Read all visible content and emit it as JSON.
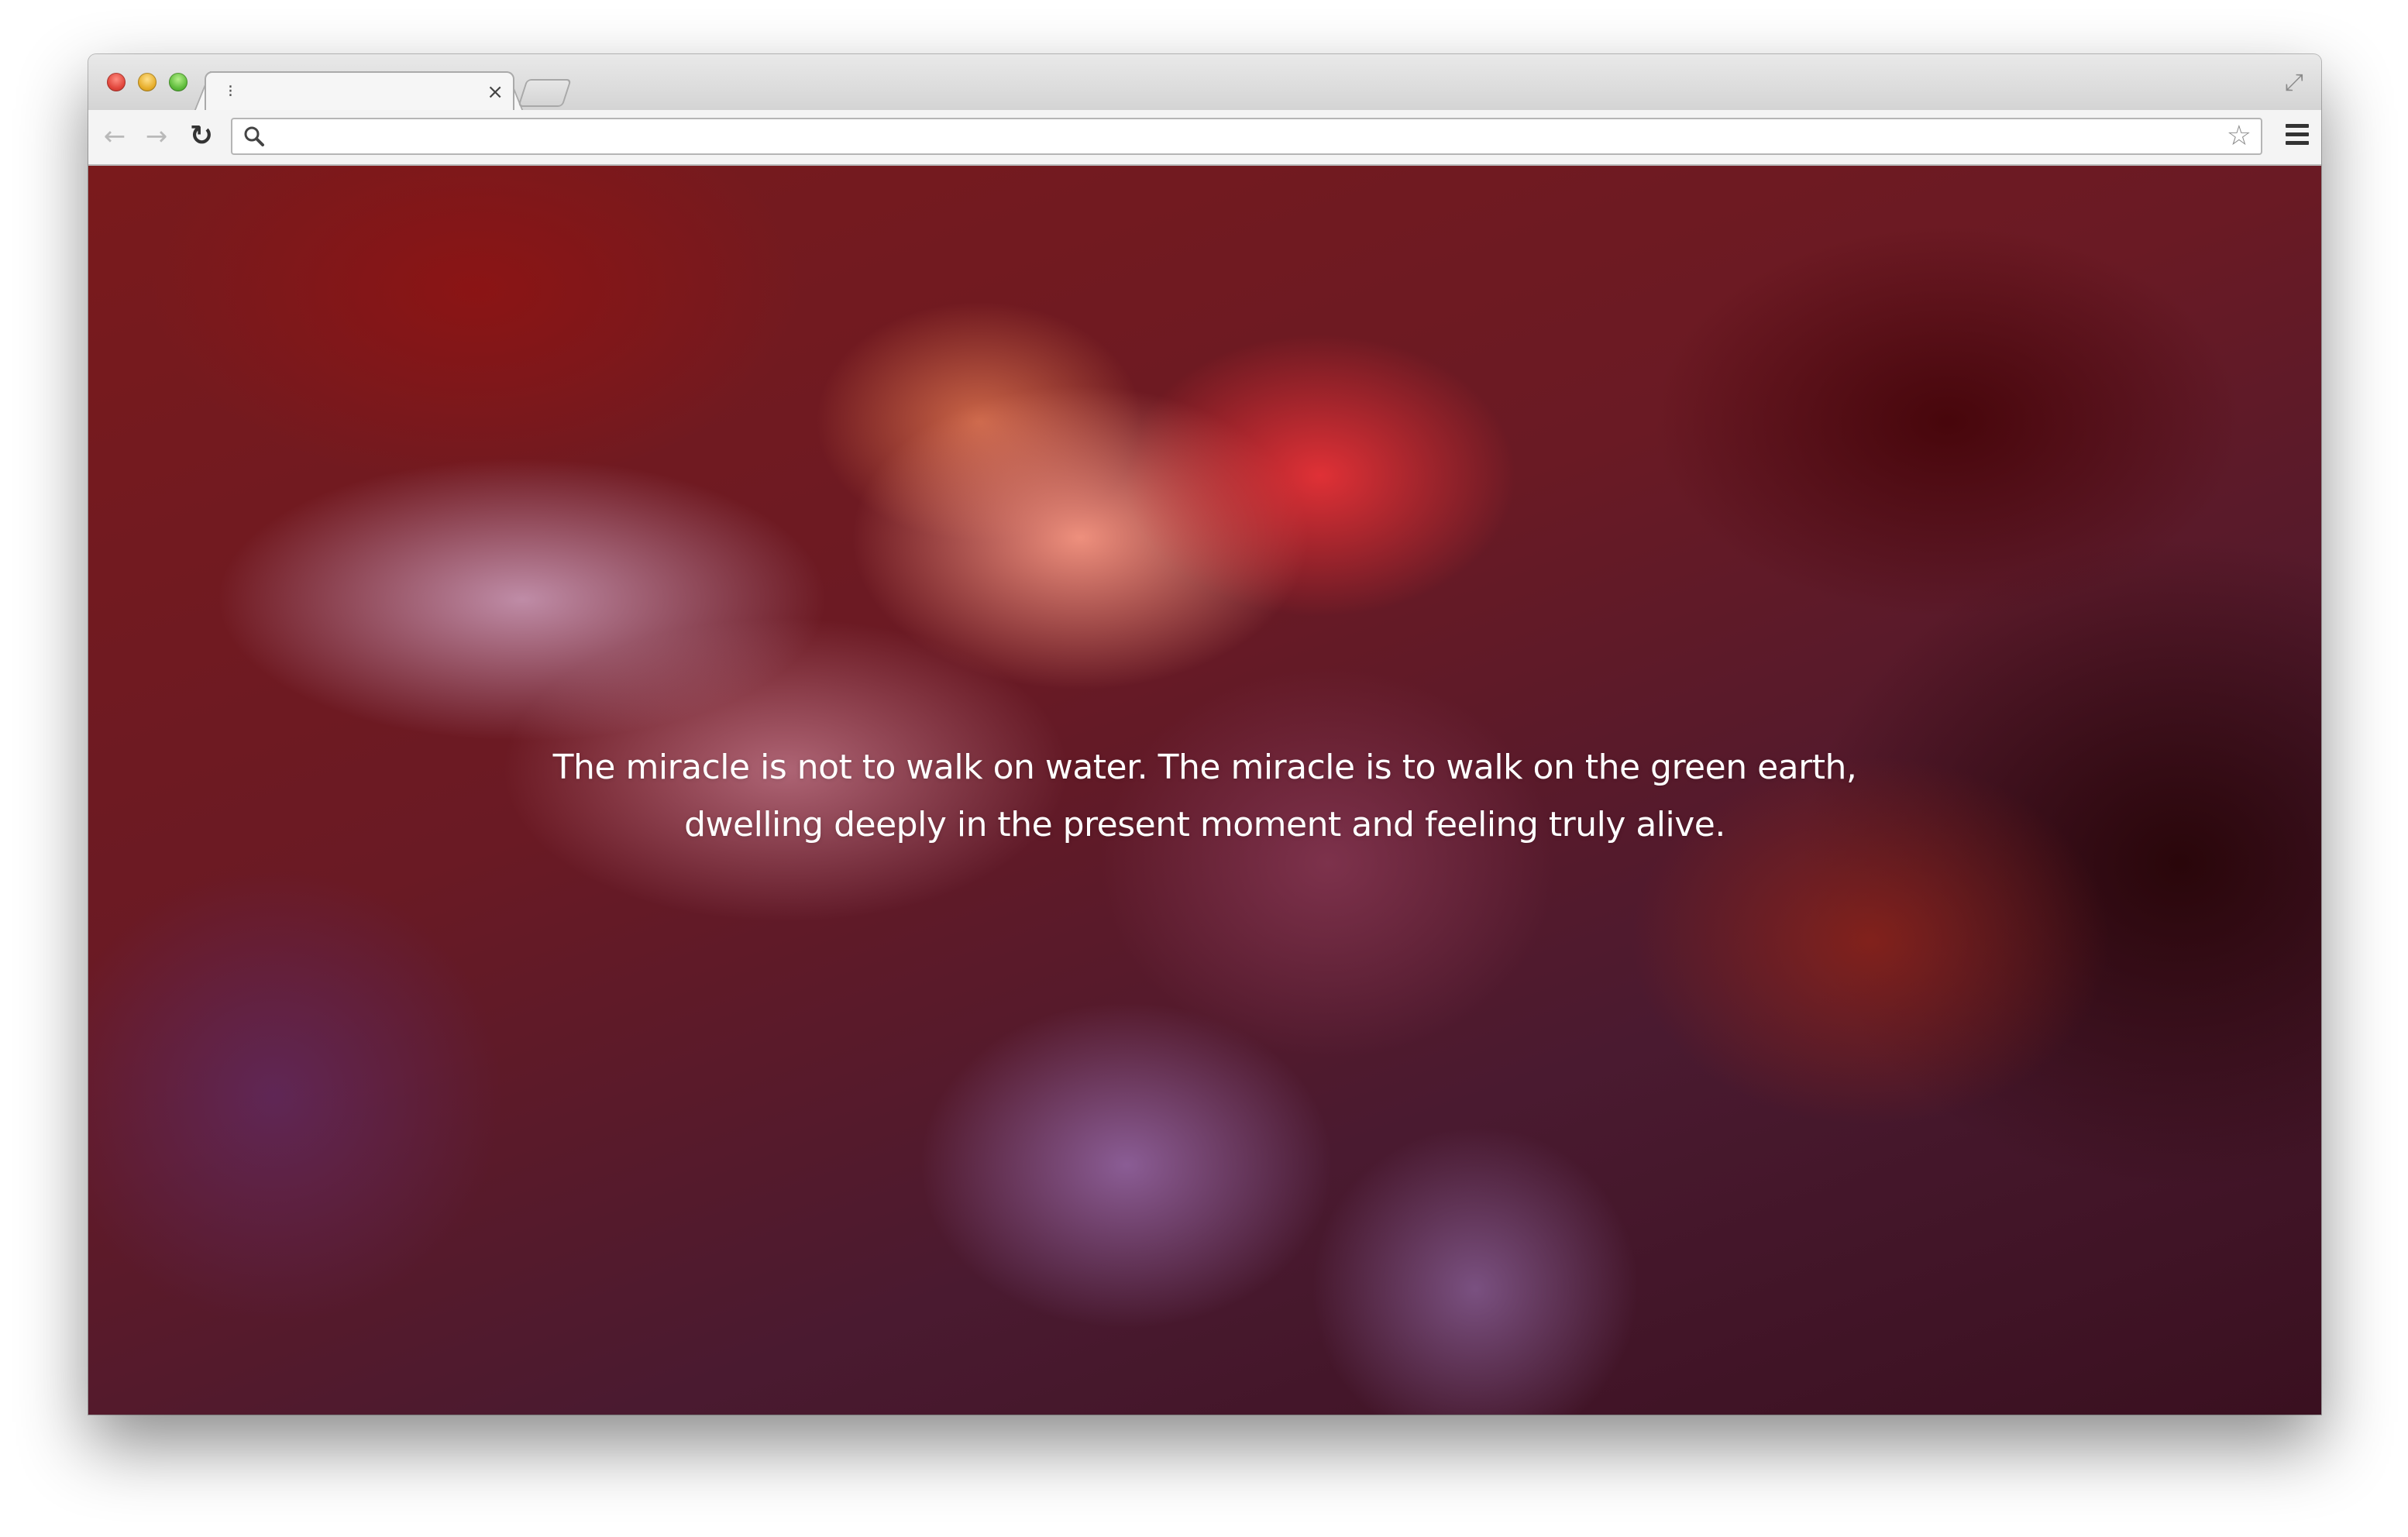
{
  "browser": {
    "tab": {
      "title": "",
      "favicon": "loading-spinner-icon",
      "close_glyph": "×"
    },
    "new_tab": {
      "icon": "new-tab-icon"
    },
    "toolbar": {
      "back_icon": "back-arrow-icon",
      "forward_icon": "forward-arrow-icon",
      "reload_icon": "reload-icon",
      "omnibox": {
        "value": "",
        "placeholder": "",
        "search_icon": "search-icon"
      },
      "bookmark_icon": "star-icon",
      "menu_icon": "hamburger-menu-icon"
    },
    "fullscreen_icon": "fullscreen-icon"
  },
  "page": {
    "quote": {
      "line1": "The miracle is not to walk on water. The miracle is to walk on the green earth,",
      "line2": "dwelling deeply in the present moment and feeling truly alive."
    },
    "colors": {
      "text": "#ffffff",
      "accent_red": "#e63237",
      "accent_pink": "#f59682",
      "accent_purple": "#9164a0",
      "dark_red": "#460508"
    }
  }
}
